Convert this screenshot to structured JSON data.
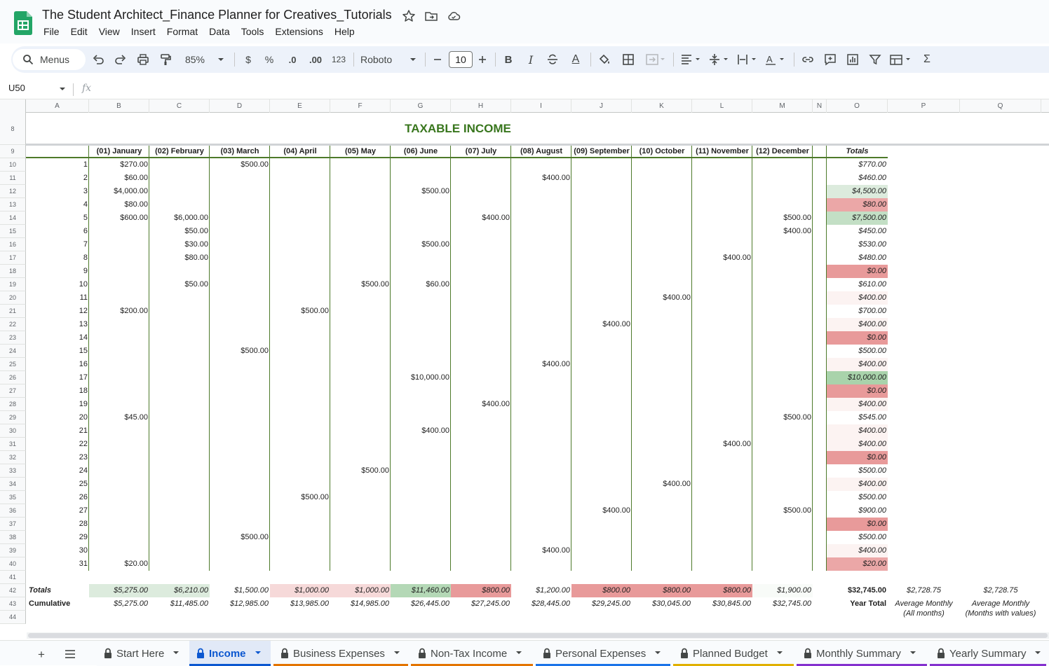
{
  "window": {
    "title": "The Student Architect_Finance Planner for Creatives_Tutorials"
  },
  "menu": [
    "File",
    "Edit",
    "View",
    "Insert",
    "Format",
    "Data",
    "Tools",
    "Extensions",
    "Help"
  ],
  "toolbar": {
    "menus_label": "Menus",
    "zoom": "85%",
    "currency": "$",
    "percent": "%",
    "dec_decrease": ".0",
    "dec_increase": ".00",
    "number_format": "123",
    "font": "Roboto",
    "font_size": "10",
    "bold": "B",
    "italic": "I",
    "text_color": "A"
  },
  "formula_bar": {
    "name_box": "U50",
    "fx": "fx",
    "value": ""
  },
  "columns": [
    "A",
    "B",
    "C",
    "D",
    "E",
    "F",
    "G",
    "H",
    "I",
    "J",
    "K",
    "L",
    "M",
    "N",
    "O",
    "P",
    "Q"
  ],
  "rows": [
    "8",
    "9",
    "10",
    "11",
    "12",
    "13",
    "14",
    "15",
    "16",
    "17",
    "18",
    "19",
    "20",
    "21",
    "22",
    "23",
    "24",
    "25",
    "26",
    "27",
    "28",
    "29",
    "30",
    "31",
    "32",
    "33",
    "34",
    "35",
    "36",
    "37",
    "38",
    "39",
    "40",
    "41",
    "42",
    "43",
    "44"
  ],
  "sheet": {
    "title": "TAXABLE INCOME",
    "month_headers": [
      "(01) January",
      "(02) February",
      "(03) March",
      "(04) April",
      "(05) May",
      "(06) June",
      "(07) July",
      "(08) August",
      "(09) September",
      "(10) October",
      "(11) November",
      "(12) December"
    ],
    "totals_header": "Totals",
    "days": [
      "1",
      "2",
      "3",
      "4",
      "5",
      "6",
      "7",
      "8",
      "9",
      "10",
      "11",
      "12",
      "13",
      "14",
      "15",
      "16",
      "17",
      "18",
      "19",
      "20",
      "21",
      "22",
      "23",
      "24",
      "25",
      "26",
      "27",
      "28",
      "29",
      "30",
      "31"
    ],
    "entries": [
      {
        "day": 1,
        "month": 0,
        "value": "$270.00"
      },
      {
        "day": 1,
        "month": 2,
        "value": "$500.00"
      },
      {
        "day": 2,
        "month": 0,
        "value": "$60.00"
      },
      {
        "day": 2,
        "month": 7,
        "value": "$400.00"
      },
      {
        "day": 3,
        "month": 0,
        "value": "$4,000.00"
      },
      {
        "day": 3,
        "month": 5,
        "value": "$500.00"
      },
      {
        "day": 4,
        "month": 0,
        "value": "$80.00"
      },
      {
        "day": 5,
        "month": 0,
        "value": "$600.00"
      },
      {
        "day": 5,
        "month": 1,
        "value": "$6,000.00"
      },
      {
        "day": 5,
        "month": 6,
        "value": "$400.00"
      },
      {
        "day": 5,
        "month": 11,
        "value": "$500.00"
      },
      {
        "day": 6,
        "month": 1,
        "value": "$50.00"
      },
      {
        "day": 6,
        "month": 11,
        "value": "$400.00"
      },
      {
        "day": 7,
        "month": 1,
        "value": "$30.00"
      },
      {
        "day": 7,
        "month": 5,
        "value": "$500.00"
      },
      {
        "day": 8,
        "month": 1,
        "value": "$80.00"
      },
      {
        "day": 8,
        "month": 10,
        "value": "$400.00"
      },
      {
        "day": 10,
        "month": 1,
        "value": "$50.00"
      },
      {
        "day": 10,
        "month": 4,
        "value": "$500.00"
      },
      {
        "day": 10,
        "month": 5,
        "value": "$60.00"
      },
      {
        "day": 11,
        "month": 9,
        "value": "$400.00"
      },
      {
        "day": 12,
        "month": 0,
        "value": "$200.00"
      },
      {
        "day": 12,
        "month": 3,
        "value": "$500.00"
      },
      {
        "day": 13,
        "month": 8,
        "value": "$400.00"
      },
      {
        "day": 15,
        "month": 2,
        "value": "$500.00"
      },
      {
        "day": 16,
        "month": 7,
        "value": "$400.00"
      },
      {
        "day": 17,
        "month": 5,
        "value": "$10,000.00"
      },
      {
        "day": 19,
        "month": 6,
        "value": "$400.00"
      },
      {
        "day": 20,
        "month": 0,
        "value": "$45.00"
      },
      {
        "day": 20,
        "month": 11,
        "value": "$500.00"
      },
      {
        "day": 21,
        "month": 5,
        "value": "$400.00"
      },
      {
        "day": 22,
        "month": 10,
        "value": "$400.00"
      },
      {
        "day": 24,
        "month": 4,
        "value": "$500.00"
      },
      {
        "day": 25,
        "month": 9,
        "value": "$400.00"
      },
      {
        "day": 26,
        "month": 3,
        "value": "$500.00"
      },
      {
        "day": 27,
        "month": 8,
        "value": "$400.00"
      },
      {
        "day": 27,
        "month": 11,
        "value": "$500.00"
      },
      {
        "day": 29,
        "month": 2,
        "value": "$500.00"
      },
      {
        "day": 30,
        "month": 7,
        "value": "$400.00"
      },
      {
        "day": 31,
        "month": 0,
        "value": "$20.00"
      }
    ],
    "day_totals": [
      {
        "value": "$770.00",
        "color": ""
      },
      {
        "value": "$460.00",
        "color": ""
      },
      {
        "value": "$4,500.00",
        "color": "#dcebdd"
      },
      {
        "value": "$80.00",
        "color": "#eba7a7"
      },
      {
        "value": "$7,500.00",
        "color": "#c3dfc5"
      },
      {
        "value": "$450.00",
        "color": ""
      },
      {
        "value": "$530.00",
        "color": ""
      },
      {
        "value": "$480.00",
        "color": ""
      },
      {
        "value": "$0.00",
        "color": "#e89a9a"
      },
      {
        "value": "$610.00",
        "color": ""
      },
      {
        "value": "$400.00",
        "color": "#fcf3f2"
      },
      {
        "value": "$700.00",
        "color": ""
      },
      {
        "value": "$400.00",
        "color": "#fcf3f2"
      },
      {
        "value": "$0.00",
        "color": "#e89a9a"
      },
      {
        "value": "$500.00",
        "color": ""
      },
      {
        "value": "$400.00",
        "color": "#fcf3f2"
      },
      {
        "value": "$10,000.00",
        "color": "#a9d3ab"
      },
      {
        "value": "$0.00",
        "color": "#e89a9a"
      },
      {
        "value": "$400.00",
        "color": "#fcf3f2"
      },
      {
        "value": "$545.00",
        "color": ""
      },
      {
        "value": "$400.00",
        "color": "#fcf3f2"
      },
      {
        "value": "$400.00",
        "color": "#fcf3f2"
      },
      {
        "value": "$0.00",
        "color": "#e89a9a"
      },
      {
        "value": "$500.00",
        "color": ""
      },
      {
        "value": "$400.00",
        "color": "#fcf3f2"
      },
      {
        "value": "$500.00",
        "color": ""
      },
      {
        "value": "$900.00",
        "color": ""
      },
      {
        "value": "$0.00",
        "color": "#e89a9a"
      },
      {
        "value": "$500.00",
        "color": ""
      },
      {
        "value": "$400.00",
        "color": "#fcf3f2"
      },
      {
        "value": "$20.00",
        "color": "#eba7a7"
      }
    ],
    "totals_label": "Totals",
    "cumulative_label": "Cumulative",
    "month_totals": [
      {
        "value": "$5,275.00",
        "color": "#dcebdd"
      },
      {
        "value": "$6,210.00",
        "color": "#dcebdd"
      },
      {
        "value": "$1,500.00",
        "color": ""
      },
      {
        "value": "$1,000.00",
        "color": "#f6d9d9"
      },
      {
        "value": "$1,000.00",
        "color": "#f6d9d9"
      },
      {
        "value": "$11,460.00",
        "color": "#b4d8b6"
      },
      {
        "value": "$800.00",
        "color": "#e89a9a"
      },
      {
        "value": "$1,200.00",
        "color": ""
      },
      {
        "value": "$800.00",
        "color": "#e89a9a"
      },
      {
        "value": "$800.00",
        "color": "#e89a9a"
      },
      {
        "value": "$800.00",
        "color": "#e89a9a"
      },
      {
        "value": "$1,900.00",
        "color": "#f8fbf8"
      }
    ],
    "cumulative": [
      "$5,275.00",
      "$11,485.00",
      "$12,985.00",
      "$13,985.00",
      "$14,985.00",
      "$26,445.00",
      "$27,245.00",
      "$28,445.00",
      "$29,245.00",
      "$30,045.00",
      "$30,845.00",
      "$32,745.00"
    ],
    "grand_total": "$32,745.00",
    "year_total_label": "Year Total",
    "avg_all": "$2,728.75",
    "avg_all_label_1": "Average Monthly",
    "avg_all_label_2": "(All months)",
    "avg_values": "$2,728.75",
    "avg_values_label_1": "Average Monthly",
    "avg_values_label_2": "(Months with values)"
  },
  "tabs": [
    {
      "label": "Start Here",
      "color": "#f9fbfd"
    },
    {
      "label": "Income",
      "color": "#0b57d0",
      "active": true
    },
    {
      "label": "Business Expenses",
      "color": "#e37400"
    },
    {
      "label": "Non-Tax Income",
      "color": "#e37400"
    },
    {
      "label": "Personal Expenses",
      "color": "#1a73e8"
    },
    {
      "label": "Planned Budget",
      "color": "#e0b000"
    },
    {
      "label": "Monthly Summary",
      "color": "#8430ce"
    },
    {
      "label": "Yearly Summary",
      "color": "#8430ce"
    }
  ],
  "colors": {
    "title_green": "#38761d",
    "grid_line": "#4d7a2a",
    "toolbar_bg": "#edf2fa",
    "active_tab": "#0b57d0"
  },
  "icons": [
    "sheets-logo",
    "star-icon",
    "move-folder-icon",
    "cloud-saved-icon",
    "search-icon",
    "undo-icon",
    "redo-icon",
    "print-icon",
    "paint-format-icon",
    "chevron-down-icon",
    "bold-icon",
    "italic-icon",
    "strikethrough-icon",
    "text-color-icon",
    "fill-color-icon",
    "borders-icon",
    "merge-icon",
    "align-icon",
    "valign-icon",
    "text-wrap-icon",
    "text-rotate-icon",
    "link-icon",
    "comment-icon",
    "chart-icon",
    "filter-icon",
    "table-icon",
    "functions-icon",
    "add-sheet-icon",
    "all-sheets-icon",
    "lock-icon"
  ]
}
